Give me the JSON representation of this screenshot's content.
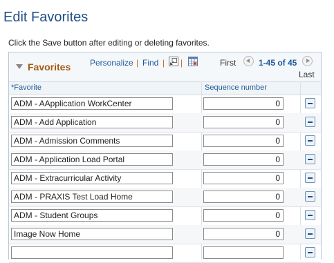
{
  "page": {
    "title": "Edit Favorites",
    "instruction": "Click the Save button after editing or deleting favorites."
  },
  "grid": {
    "title": "Favorites",
    "links": {
      "personalize": "Personalize",
      "find": "Find",
      "separator": "|"
    },
    "icons": [
      "view-all-icon",
      "download-excel-icon"
    ],
    "pagination": {
      "first": "First",
      "range": "1-45 of 45",
      "last": "Last"
    },
    "columns": {
      "favorite": "*Favorite",
      "sequence": "Sequence number"
    },
    "rows": [
      {
        "favorite": "ADM - AApplication WorkCenter",
        "sequence": "0"
      },
      {
        "favorite": "ADM - Add Application",
        "sequence": "0"
      },
      {
        "favorite": "ADM - Admission Comments",
        "sequence": "0"
      },
      {
        "favorite": "ADM - Application Load Portal",
        "sequence": "0"
      },
      {
        "favorite": "ADM - Extracurricular Activity",
        "sequence": "0"
      },
      {
        "favorite": "ADM - PRAXIS Test Load Home",
        "sequence": "0"
      },
      {
        "favorite": "ADM - Student Groups",
        "sequence": "0"
      },
      {
        "favorite": "Image Now Home",
        "sequence": "0"
      },
      {
        "favorite": "",
        "sequence": ""
      }
    ]
  },
  "colors": {
    "title": "#1f4e87",
    "grid_title": "#a35a13",
    "link": "#1f5a99"
  }
}
